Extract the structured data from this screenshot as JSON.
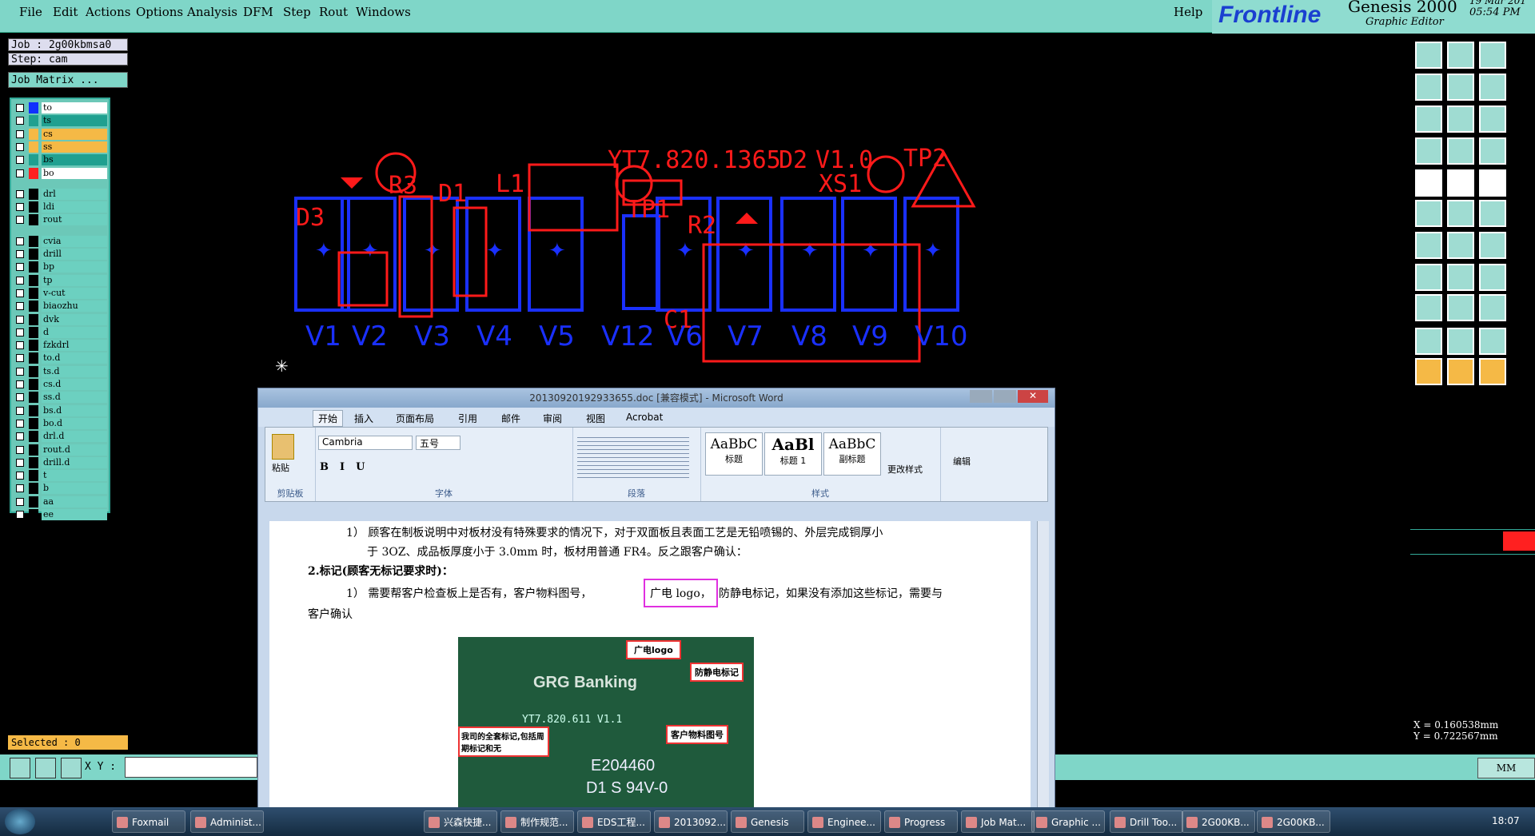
{
  "menu": [
    "File",
    "Edit",
    "Actions",
    "Options",
    "Analysis",
    "DFM",
    "Step",
    "Rout",
    "Windows"
  ],
  "help_label": "Help",
  "brand": {
    "logo": "Frontline",
    "product": "Genesis 2000",
    "subtitle": "Graphic Editor",
    "time": "05:54 PM",
    "date_partial": "19 Mar 201"
  },
  "job": {
    "job_label": "Job : 2g00kbmsa0",
    "step_label": "Step: cam",
    "matrix_button": "Job Matrix ..."
  },
  "layers_group1": [
    {
      "name": "to",
      "color": "#1030ff"
    },
    {
      "name": "ts",
      "color": "#20a090"
    },
    {
      "name": "cs",
      "color": "#f5b946"
    },
    {
      "name": "ss",
      "color": "#f5b946"
    },
    {
      "name": "bs",
      "color": "#20a090"
    },
    {
      "name": "bo",
      "color": "#ff2020"
    }
  ],
  "layers_group2": [
    {
      "name": "drl"
    },
    {
      "name": "ldi"
    },
    {
      "name": "rout"
    }
  ],
  "layers_group3": [
    {
      "name": "cvia"
    },
    {
      "name": "drill"
    },
    {
      "name": "bp"
    },
    {
      "name": "tp"
    },
    {
      "name": "v-cut"
    },
    {
      "name": "biaozhu"
    },
    {
      "name": "dvk"
    },
    {
      "name": "d"
    },
    {
      "name": "fzkdrl"
    },
    {
      "name": "to.d"
    },
    {
      "name": "ts.d"
    },
    {
      "name": "cs.d"
    },
    {
      "name": "ss.d"
    },
    {
      "name": "bs.d"
    },
    {
      "name": "bo.d"
    },
    {
      "name": "drl.d"
    },
    {
      "name": "rout.d"
    },
    {
      "name": "drill.d"
    },
    {
      "name": "t"
    },
    {
      "name": "b"
    },
    {
      "name": "aa"
    },
    {
      "name": "ee"
    }
  ],
  "selected_label": "Selected : 0",
  "xy_label": "X Y :",
  "coords": {
    "x": "X = 0.160538mm",
    "y": "Y = 0.722567mm"
  },
  "units_label": "MM",
  "canvas": {
    "labels": [
      "V1",
      "V2",
      "V3",
      "V4",
      "V5",
      "V12",
      "V6",
      "V7",
      "V8",
      "V9",
      "V10"
    ],
    "red_texts": [
      "D3",
      "R3",
      "D1",
      "L1",
      "YT7.820.1365",
      "D2",
      "V1.0",
      "TP2",
      "XS1",
      "TP1",
      "R2",
      "C1"
    ]
  },
  "word": {
    "title": "20130920192933655.doc [兼容模式] - Microsoft Word",
    "tabs": [
      "开始",
      "插入",
      "页面布局",
      "引用",
      "邮件",
      "审阅",
      "视图",
      "Acrobat"
    ],
    "font_name": "Cambria",
    "font_size": "五号",
    "groups": [
      "剪贴板",
      "字体",
      "段落",
      "样式",
      "编辑"
    ],
    "paste_label": "粘贴",
    "styles": [
      {
        "sample": "AaBbC",
        "name": "标题"
      },
      {
        "sample": "AaBl",
        "name": "标题 1"
      },
      {
        "sample": "AaBbC",
        "name": "副标题"
      }
    ],
    "change_style": "更改样式",
    "edit_label": "编辑",
    "para1": "1） 顾客在制板说明中对板材没有特殊要求的情况下，对于双面板且表面工艺是无铅喷锡的、外层完成铜厚小",
    "para1b": "于 3OZ、成品板厚度小于 3.0mm 时，板材用普通 FR4。反之跟客户确认：",
    "heading2": "2.标记(顾客无标记要求时)：",
    "para2a": "1） 需要帮客户检查板上是否有，客户物料图号，",
    "para2_highlight": "广电 logo，",
    "para2b": "防静电标记，如果没有添加这些标记，需要与",
    "para2c": "客户确认",
    "pcb_callouts": [
      "广电logo",
      "防静电标记",
      "客户物料图号",
      "我司的全套标记,包括周期标记和无"
    ],
    "pcb_texts": [
      "GRG Banking",
      "YT7.820.611 V1.1",
      "E204460",
      "D1 S 94V-0"
    ]
  },
  "taskbar": [
    "Foxmail",
    "Administ...",
    "兴森快捷...",
    "制作规范...",
    "EDS工程...",
    "2013092...",
    "Genesis",
    "Enginee...",
    "Progress",
    "Job Mat...",
    "Graphic ...",
    "Drill Too...",
    "2G00KB...",
    "2G00KB..."
  ],
  "clock": "18:07"
}
